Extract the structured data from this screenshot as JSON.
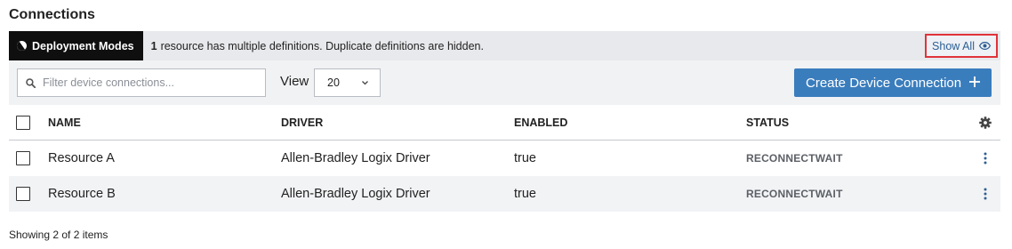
{
  "page": {
    "title": "Connections"
  },
  "banner": {
    "chip_label": "Deployment Modes",
    "count": "1",
    "message": "resource has multiple definitions. Duplicate definitions are hidden.",
    "show_all_label": "Show All"
  },
  "toolbar": {
    "search_placeholder": "Filter device connections...",
    "view_label": "View",
    "view_value": "20",
    "create_label": "Create Device Connection"
  },
  "table": {
    "columns": [
      "NAME",
      "DRIVER",
      "ENABLED",
      "STATUS"
    ],
    "rows": [
      {
        "name": "Resource A",
        "driver": "Allen-Bradley Logix Driver",
        "enabled": "true",
        "status": "RECONNECTWAIT"
      },
      {
        "name": "Resource B",
        "driver": "Allen-Bradley Logix Driver",
        "enabled": "true",
        "status": "RECONNECTWAIT"
      }
    ]
  },
  "footer": {
    "summary": "Showing 2 of 2 items"
  },
  "icons": {
    "deployment": "deployment-mode-icon",
    "show_all": "eye-icon",
    "search": "search-icon",
    "view": "chevron-down-icon",
    "create": "plus-icon",
    "settings": "gear-icon",
    "row_menu": "kebab-menu-icon"
  },
  "colors": {
    "accent": "#3a7dbd",
    "link": "#2d5f94",
    "highlight_border": "#e0333a",
    "chip_bg": "#0f0f10"
  }
}
